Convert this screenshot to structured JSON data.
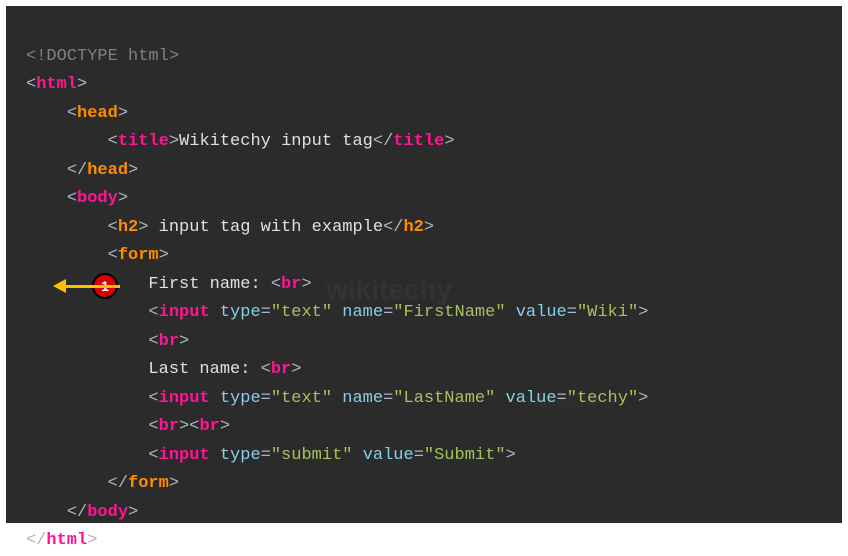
{
  "code": {
    "doctype": "<!DOCTYPE html>",
    "html_open": "html",
    "head_open": "head",
    "title_open": "title",
    "title_text": "Wikitechy input tag",
    "title_close": "title",
    "head_close": "head",
    "body_open": "body",
    "h2_open": "h2",
    "h2_text": " input tag with example",
    "h2_close": "h2",
    "form_open": "form",
    "first_label": "First name: ",
    "br": "br",
    "input_tag": "input",
    "type_attr": "type",
    "name_attr": "name",
    "value_attr": "value",
    "text_val": "\"text\"",
    "firstname_val": "\"FirstName\"",
    "wiki_val": "\"Wiki\"",
    "last_label": "Last name: ",
    "lastname_val": "\"LastName\"",
    "techy_val": "\"techy\"",
    "submit_val_type": "\"submit\"",
    "submit_val": "\"Submit\"",
    "form_close": "form",
    "body_close": "body",
    "html_close": "html"
  },
  "callout_number": "1",
  "watermark": "wikitechy"
}
